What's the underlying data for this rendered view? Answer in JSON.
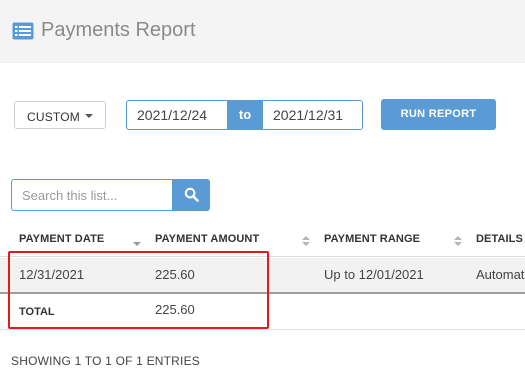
{
  "header": {
    "title": "Payments Report",
    "icon": "list-icon",
    "accent": "#5b9bd5"
  },
  "filters": {
    "range_label": "CUSTOM",
    "start_date": "2021/12/24",
    "to_label": "to",
    "end_date": "2021/12/31",
    "run_label": "RUN REPORT"
  },
  "search": {
    "placeholder": "Search this list...",
    "icon": "search-icon"
  },
  "table": {
    "columns": [
      "PAYMENT DATE",
      "PAYMENT AMOUNT",
      "PAYMENT RANGE",
      "DETAILS"
    ],
    "rows": [
      {
        "payment_date": "12/31/2021",
        "payment_amount": "225.60",
        "payment_range": "Up to 12/01/2021",
        "details": "Automat"
      }
    ],
    "total": {
      "label": "TOTAL",
      "amount": "225.60"
    }
  },
  "footer": {
    "entries_info": "SHOWING 1 TO 1 OF 1 ENTRIES"
  },
  "highlight_color": "#e01b1b"
}
